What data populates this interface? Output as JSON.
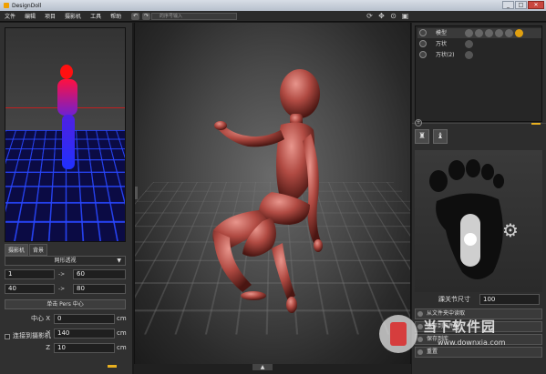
{
  "window": {
    "title": "DesignDoll"
  },
  "menu": [
    "文件",
    "编辑",
    "项目",
    "摄影机",
    "工具",
    "帮助"
  ],
  "toolbar": {
    "search_placeholder": "的序号输入"
  },
  "left": {
    "tabs": [
      "摄影机",
      "背景"
    ],
    "projection": "网形透视",
    "row1": {
      "a": "1",
      "arrow": "->",
      "b": "60"
    },
    "row2": {
      "a": "40",
      "arrow": "->",
      "b": "80"
    },
    "pers_center_button": "单击 Pers 中心",
    "center_x_label": "中心 X",
    "center_x": "0",
    "y_label": "Y",
    "y": "140",
    "z_label": "Z",
    "z": "10",
    "unit": "cm",
    "connect_label": "连接到摄影机"
  },
  "layers": [
    {
      "name": "模型"
    },
    {
      "name": "万状"
    },
    {
      "name": "万状(2)"
    }
  ],
  "right": {
    "joint_label": "踝关节尺寸",
    "joint_value": "100",
    "buttons": [
      "从文件夹中读取",
      "保存到文件夹",
      "保存到库",
      "重置"
    ]
  },
  "watermark": {
    "text": "当下软件园",
    "url": "www.downxia.com"
  },
  "colors": {
    "accent": "#e8b020",
    "grid_blue": "#2846ff",
    "figure": "#a8443e"
  }
}
